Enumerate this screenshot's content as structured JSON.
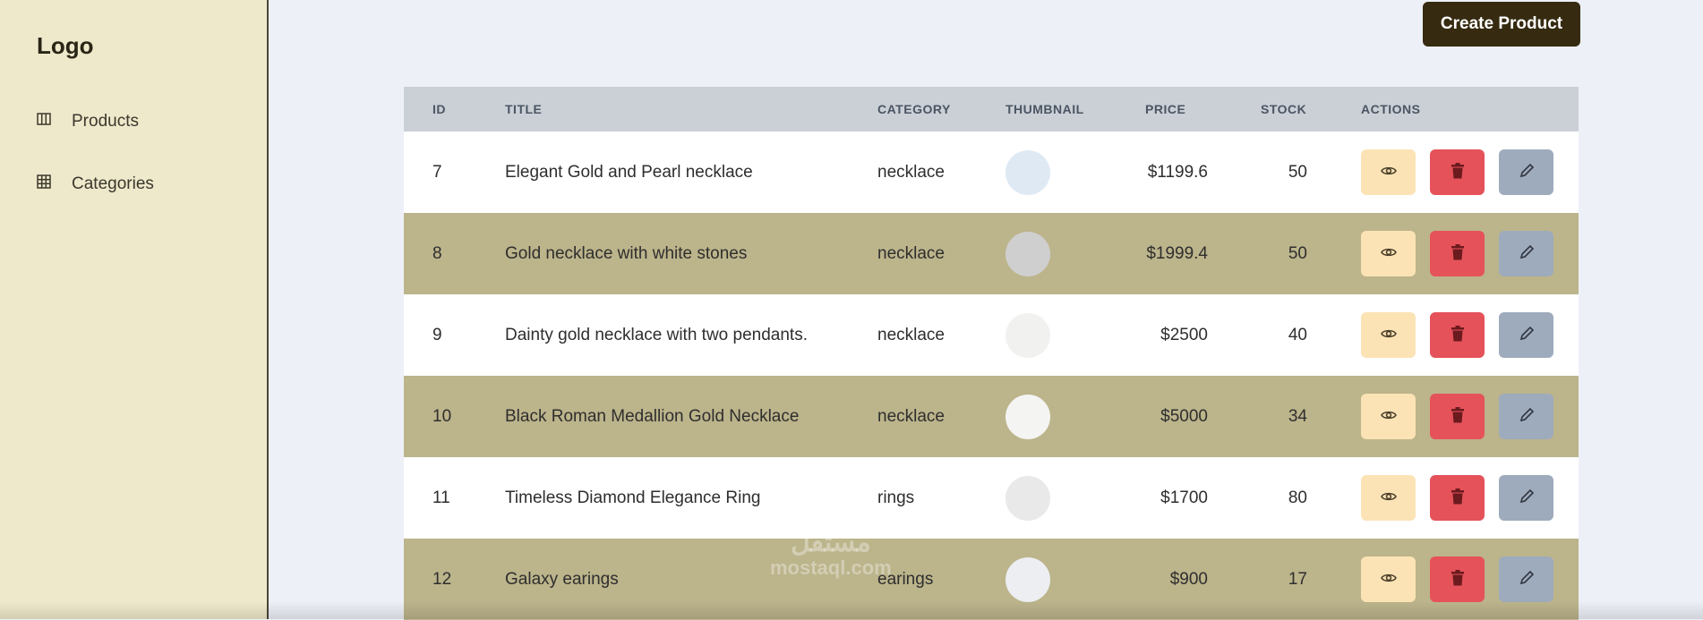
{
  "sidebar": {
    "logo": "Logo",
    "items": [
      {
        "label": "Products",
        "icon": "columns-icon"
      },
      {
        "label": "Categories",
        "icon": "table-icon"
      }
    ]
  },
  "toolbar": {
    "create_label": "Create Product"
  },
  "table": {
    "headers": [
      "ID",
      "TITLE",
      "CATEGORY",
      "THUMBNAIL",
      "PRICE",
      "STOCK",
      "ACTIONS"
    ],
    "rows": [
      {
        "id": "7",
        "title": "Elegant Gold and Pearl necklace",
        "category": "necklace",
        "price": "$1199.6",
        "stock": "50"
      },
      {
        "id": "8",
        "title": "Gold necklace with white stones",
        "category": "necklace",
        "price": "$1999.4",
        "stock": "50"
      },
      {
        "id": "9",
        "title": "Dainty gold necklace with two pendants.",
        "category": "necklace",
        "price": "$2500",
        "stock": "40"
      },
      {
        "id": "10",
        "title": "Black Roman Medallion Gold Necklace",
        "category": "necklace",
        "price": "$5000",
        "stock": "34"
      },
      {
        "id": "11",
        "title": "Timeless Diamond Elegance Ring",
        "category": "rings",
        "price": "$1700",
        "stock": "80"
      },
      {
        "id": "12",
        "title": "Galaxy earings",
        "category": "earings",
        "price": "$900",
        "stock": "17"
      }
    ]
  },
  "watermark": {
    "arabic": "مستقل",
    "latin": "mostaql.com"
  },
  "colors": {
    "sidebar": "#efe9cc",
    "accent": "#362b11",
    "row_alt": "#bcb48b",
    "view": "#fbe3b5",
    "delete": "#e5525a",
    "edit": "#9eabbc"
  }
}
